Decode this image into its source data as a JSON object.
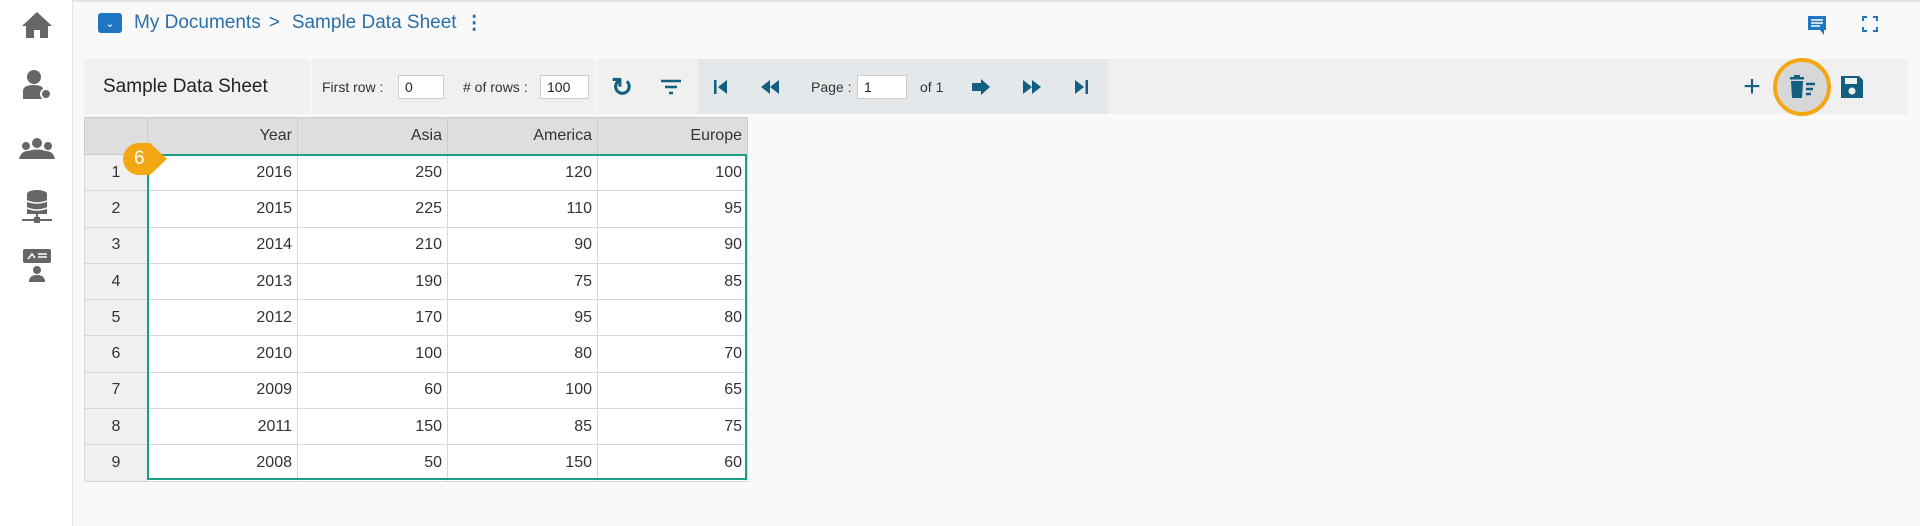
{
  "breadcrumb": {
    "root": "My Documents",
    "separator": ">",
    "current": "Sample Data Sheet"
  },
  "toolbar": {
    "title": "Sample Data Sheet",
    "first_row_label": "First row :",
    "first_row_value": "0",
    "rows_label": "# of rows :",
    "rows_value": "100",
    "page_label": "Page :",
    "page_value": "1",
    "page_of": "of 1"
  },
  "table": {
    "columns": [
      "Year",
      "Asia",
      "America",
      "Europe"
    ],
    "rows": [
      [
        "1",
        "2016",
        "250",
        "120",
        "100"
      ],
      [
        "2",
        "2015",
        "225",
        "110",
        "95"
      ],
      [
        "3",
        "2014",
        "210",
        "90",
        "90"
      ],
      [
        "4",
        "2013",
        "190",
        "75",
        "85"
      ],
      [
        "5",
        "2012",
        "170",
        "95",
        "80"
      ],
      [
        "6",
        "2010",
        "100",
        "80",
        "70"
      ],
      [
        "7",
        "2009",
        "60",
        "100",
        "65"
      ],
      [
        "8",
        "2011",
        "150",
        "85",
        "75"
      ],
      [
        "9",
        "2008",
        "50",
        "150",
        "60"
      ]
    ]
  },
  "step_badge": "6",
  "colors": {
    "accent": "#11607f",
    "highlight": "#f3a712",
    "selection": "#1b9e8a"
  }
}
